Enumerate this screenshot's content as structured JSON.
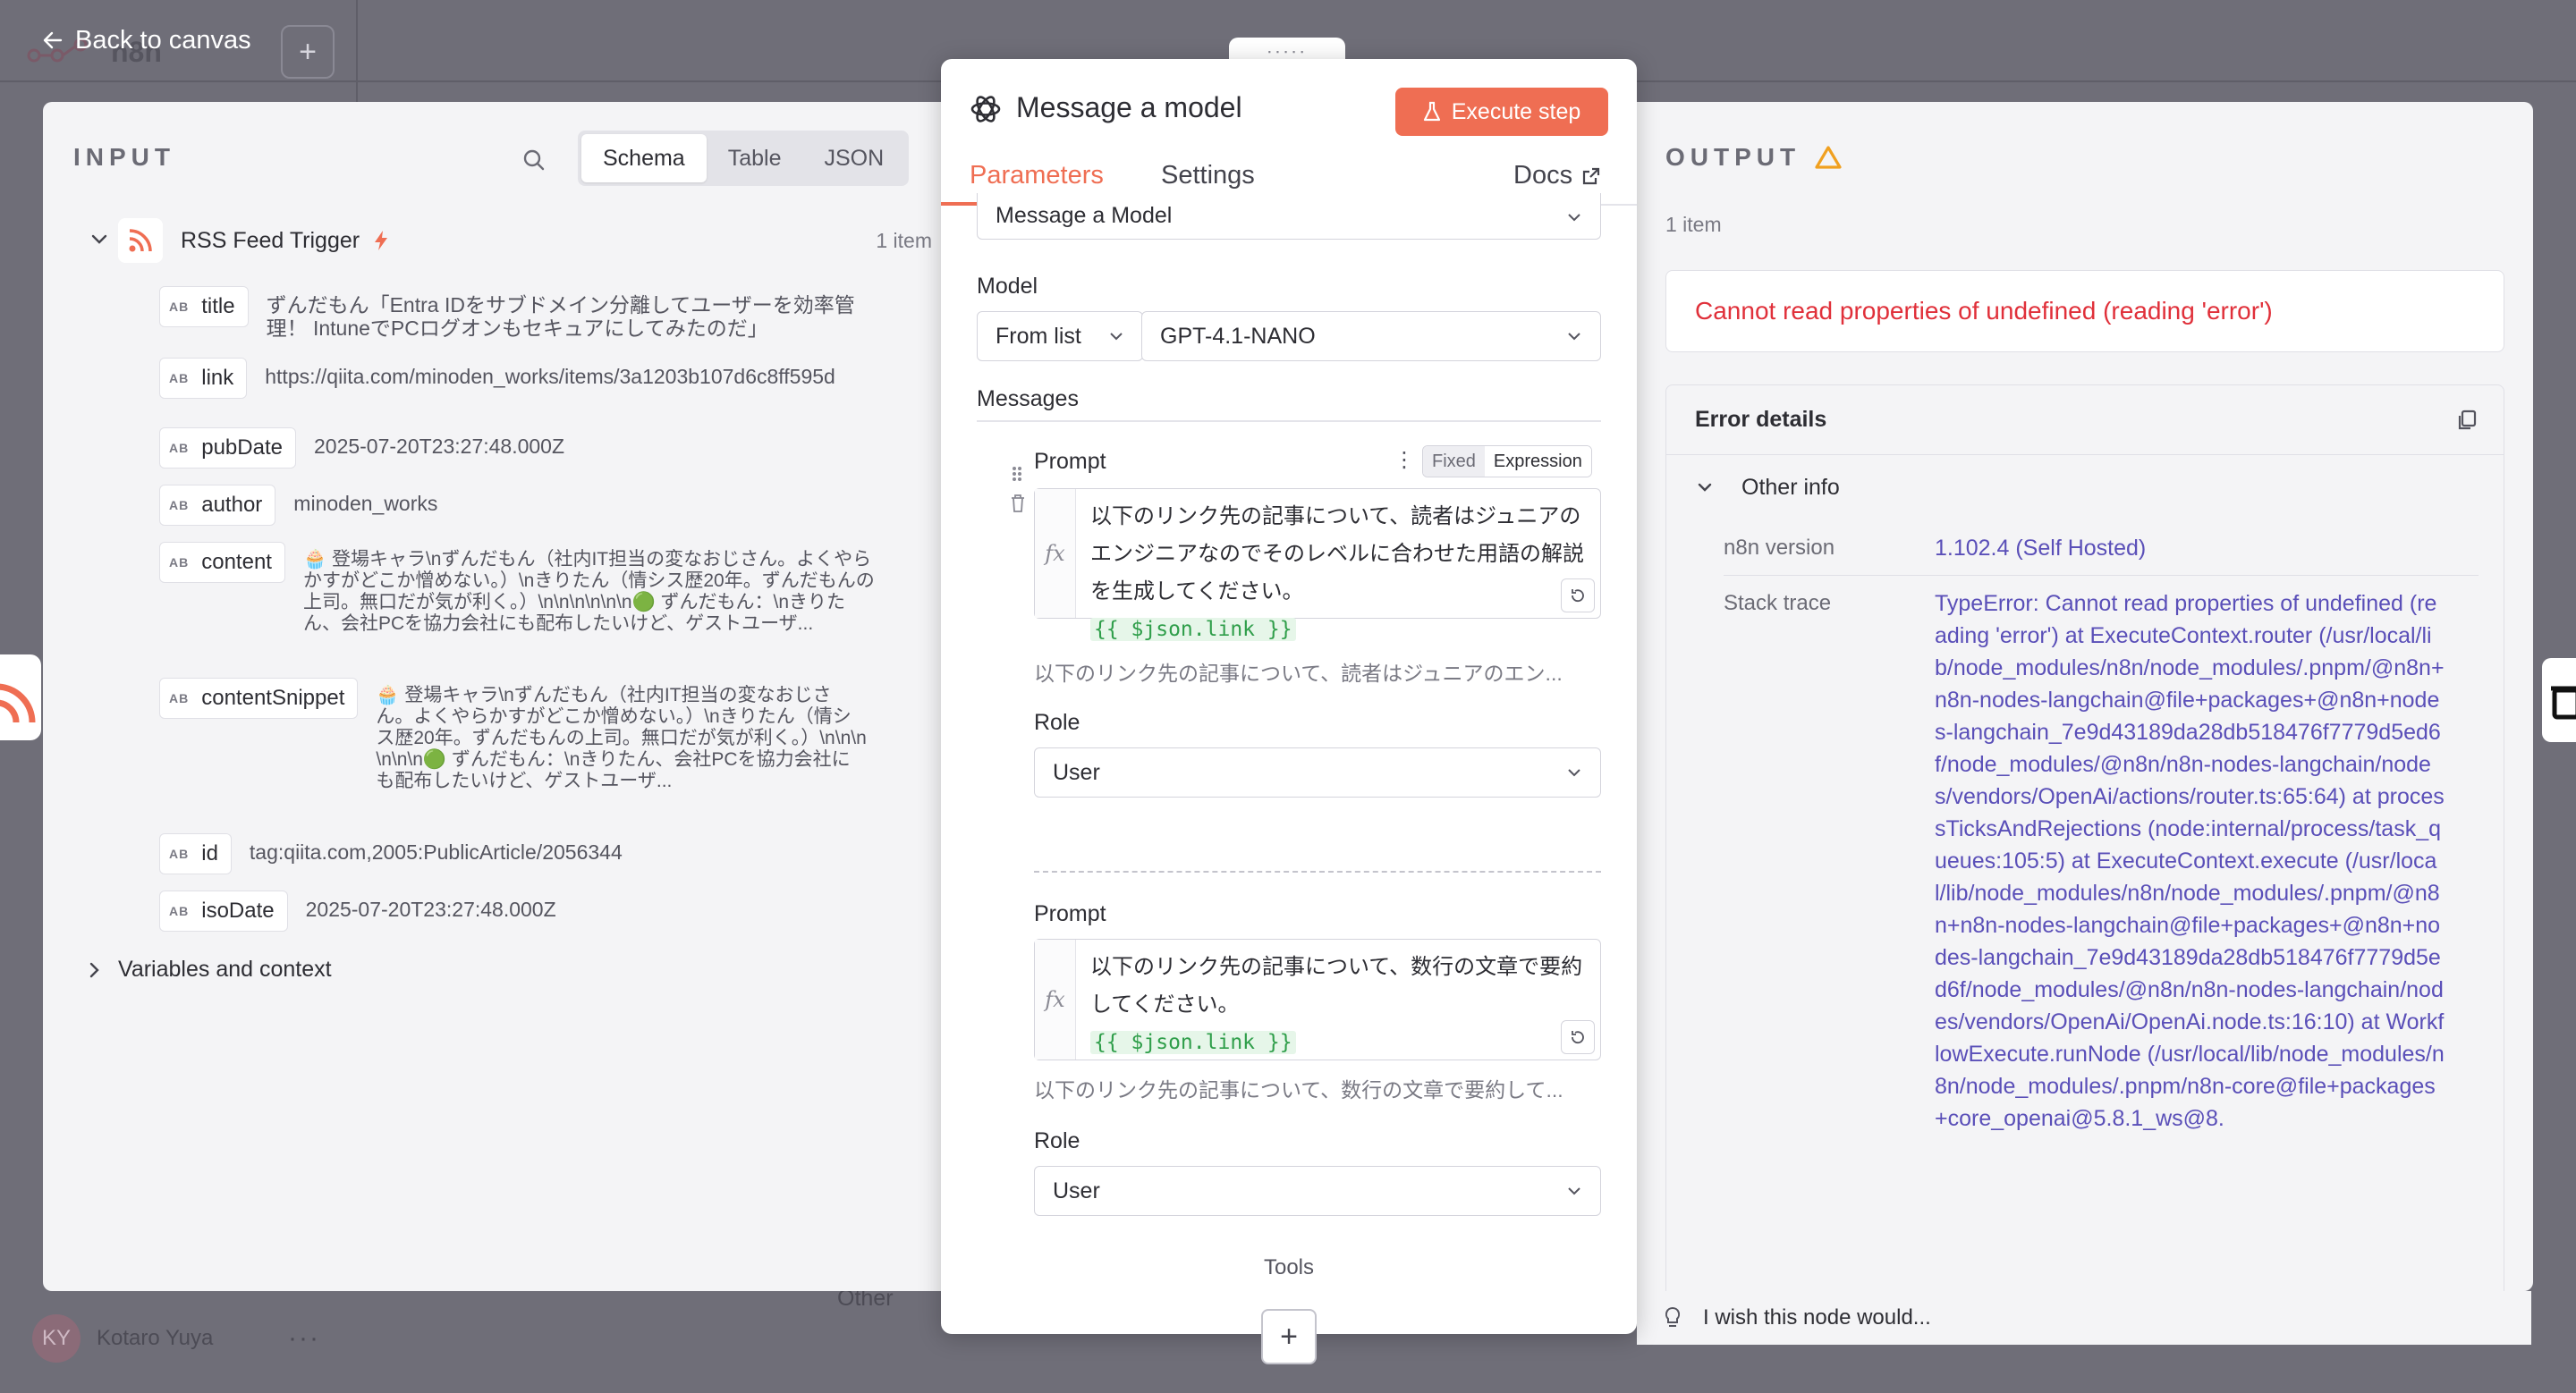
{
  "top_bar": {
    "back_label": "Back to canvas",
    "logo_text": "n8n",
    "add_label": "+"
  },
  "background": {
    "user_initials": "KY",
    "user_name": "Kotaro Yuya",
    "user_more": "···",
    "other_label": "Other"
  },
  "input": {
    "heading": "INPUT",
    "view_tabs": [
      "Schema",
      "Table",
      "JSON"
    ],
    "active_view": "Schema",
    "trigger": {
      "name": "RSS Feed Trigger",
      "count": "1 item"
    },
    "fields": [
      {
        "type": "AB",
        "name": "title",
        "value": "ずんだもん「Entra IDをサブドメイン分離してユーザーを効率管理！ IntuneでPCログオンもセキュアにしてみたのだ」"
      },
      {
        "type": "AB",
        "name": "link",
        "value": "https://qiita.com/minoden_works/items/3a1203b107d6c8ff595d"
      },
      {
        "type": "AB",
        "name": "pubDate",
        "value": "2025-07-20T23:27:48.000Z"
      },
      {
        "type": "AB",
        "name": "author",
        "value": "minoden_works"
      },
      {
        "type": "AB",
        "name": "content",
        "value": "🧁 登場キャラ\\nずんだもん（社内IT担当の変なおじさん。よくやらかすがどこか憎めない。）\\nきりたん（情シス歴20年。ずんだもんの上司。無口だが気が利く。）\\n\\n\\n\\n\\n\\n🟢 ずんだもん：\\nきりたん、会社PCを協力会社にも配布したいけど、ゲストユーザ..."
      },
      {
        "type": "AB",
        "name": "contentSnippet",
        "value": "🧁 登場キャラ\\nずんだもん（社内IT担当の変なおじさん。よくやらかすがどこか憎めない。）\\nきりたん（情シス歴20年。ずんだもんの上司。無口だが気が利く。）\\n\\n\\n\\n\\n\\n🟢 ずんだもん：\\nきりたん、会社PCを協力会社にも配布したいけど、ゲストユーザ..."
      },
      {
        "type": "AB",
        "name": "id",
        "value": "tag:qiita.com,2005:PublicArticle/2056344"
      },
      {
        "type": "AB",
        "name": "isoDate",
        "value": "2025-07-20T23:27:48.000Z"
      }
    ],
    "variables_label": "Variables and context"
  },
  "node": {
    "drag_handle": ":::::",
    "title": "Message a model",
    "execute_label": "Execute step",
    "tabs": {
      "parameters": "Parameters",
      "settings": "Settings",
      "docs": "Docs"
    },
    "operation_value": "Message a Model",
    "model_label": "Model",
    "model_mode": "From list",
    "model_value": "GPT-4.1-NANO",
    "messages_label": "Messages",
    "messages": [
      {
        "prompt_label": "Prompt",
        "text": "以下のリンク先の記事について、読者はジュニアのエンジニアなのでそのレベルに合わせた用語の解説を生成してください。",
        "expression": "{{ $json.link }}",
        "preview": "以下のリンク先の記事について、読者はジュニアのエン...",
        "role_label": "Role",
        "role_value": "User"
      },
      {
        "prompt_label": "Prompt",
        "text": "以下のリンク先の記事について、数行の文章で要約してください。",
        "expression": "{{ $json.link }}",
        "preview": "以下のリンク先の記事について、数行の文章で要約して...",
        "role_label": "Role",
        "role_value": "User"
      }
    ],
    "fixed_label": "Fixed",
    "expression_label": "Expression",
    "fx_label": "fx",
    "tools_label": "Tools",
    "add_tool_label": "+"
  },
  "output": {
    "heading": "OUTPUT",
    "count": "1 item",
    "error_message": "Cannot read properties of undefined (reading 'error')",
    "details_title": "Error details",
    "other_info_label": "Other info",
    "version_label": "n8n version",
    "version_value": "1.102.4 (Self Hosted)",
    "stack_label": "Stack trace",
    "stack_value": "TypeError: Cannot read properties of undefined (reading 'error') at ExecuteContext.router (/usr/local/lib/node_modules/n8n/node_modules/.pnpm/@n8n+n8n-nodes-langchain@file+packages+@n8n+nodes-langchain_7e9d43189da28db518476f7779d5ed6f/node_modules/@n8n/n8n-nodes-langchain/nodes/vendors/OpenAi/actions/router.ts:65:64) at processTicksAndRejections (node:internal/process/task_queues:105:5) at ExecuteContext.execute (/usr/local/lib/node_modules/n8n/node_modules/.pnpm/@n8n+n8n-nodes-langchain@file+packages+@n8n+nodes-langchain_7e9d43189da28db518476f7779d5ed6f/node_modules/@n8n/n8n-nodes-langchain/nodes/vendors/OpenAi/OpenAi.node.ts:16:10) at WorkflowExecute.runNode (/usr/local/lib/node_modules/n8n/node_modules/.pnpm/n8n-core@file+packages+core_openai@5.8.1_ws@8."
  },
  "feedback": {
    "label": "I wish this node would..."
  },
  "colors": {
    "accent": "#ef6e53",
    "error": "#e0303a",
    "link": "#5a4fb8",
    "warning": "#f0a020",
    "expression": "#2f9e4a"
  }
}
